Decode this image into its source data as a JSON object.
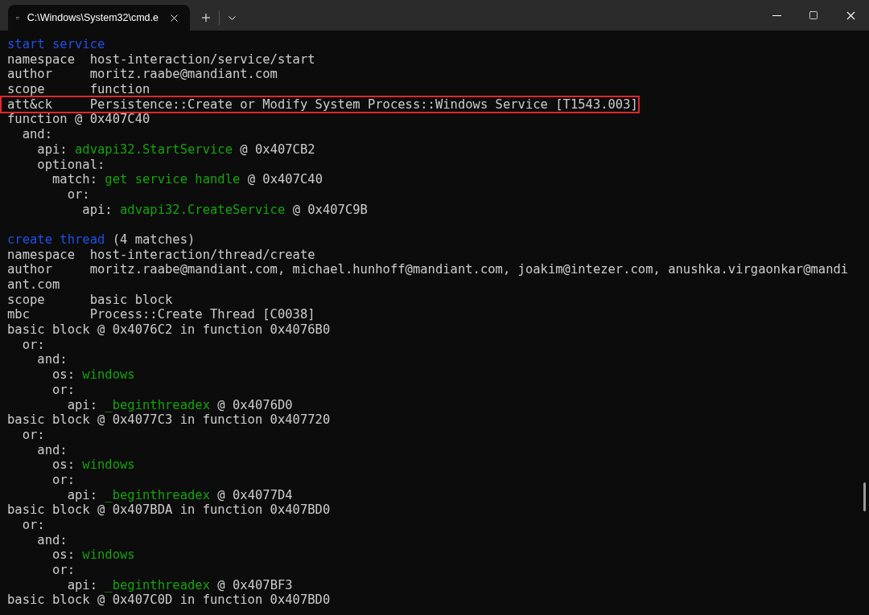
{
  "window": {
    "tab_title": "C:\\Windows\\System32\\cmd.e"
  },
  "lines": [
    {
      "segments": [
        {
          "text": "start service",
          "kind": "heading"
        }
      ]
    },
    {
      "segments": [
        {
          "text": "namespace  host-interaction/service/start",
          "kind": "plain"
        }
      ]
    },
    {
      "segments": [
        {
          "text": "author     moritz.raabe@mandiant.com",
          "kind": "plain"
        }
      ]
    },
    {
      "segments": [
        {
          "text": "scope      function",
          "kind": "plain"
        }
      ]
    },
    {
      "highlighted": true,
      "segments": [
        {
          "text": "att&ck     Persistence::Create or Modify System Process::Windows Service [T1543.003]",
          "kind": "plain"
        }
      ]
    },
    {
      "segments": [
        {
          "text": "function @ 0x407C40",
          "kind": "plain"
        }
      ]
    },
    {
      "segments": [
        {
          "text": "  and:",
          "kind": "plain"
        }
      ]
    },
    {
      "segments": [
        {
          "text": "    api: ",
          "kind": "plain"
        },
        {
          "text": "advapi32.StartService",
          "kind": "match"
        },
        {
          "text": " @ 0x407CB2",
          "kind": "plain"
        }
      ]
    },
    {
      "segments": [
        {
          "text": "    optional:",
          "kind": "plain"
        }
      ]
    },
    {
      "segments": [
        {
          "text": "      match: ",
          "kind": "plain"
        },
        {
          "text": "get service handle",
          "kind": "match"
        },
        {
          "text": " @ 0x407C40",
          "kind": "plain"
        }
      ]
    },
    {
      "segments": [
        {
          "text": "        or:",
          "kind": "plain"
        }
      ]
    },
    {
      "segments": [
        {
          "text": "          api: ",
          "kind": "plain"
        },
        {
          "text": "advapi32.CreateService",
          "kind": "match"
        },
        {
          "text": " @ 0x407C9B",
          "kind": "plain"
        }
      ]
    },
    {
      "gap_before": true,
      "segments": [
        {
          "text": "create thread",
          "kind": "heading"
        },
        {
          "text": " (4 matches)",
          "kind": "plain"
        }
      ]
    },
    {
      "segments": [
        {
          "text": "namespace  host-interaction/thread/create",
          "kind": "plain"
        }
      ]
    },
    {
      "segments": [
        {
          "text": "author     moritz.raabe@mandiant.com, michael.hunhoff@mandiant.com, joakim@intezer.com, anushka.virgaonkar@mandi",
          "kind": "plain"
        }
      ]
    },
    {
      "segments": [
        {
          "text": "ant.com",
          "kind": "plain"
        }
      ]
    },
    {
      "segments": [
        {
          "text": "scope      basic block",
          "kind": "plain"
        }
      ]
    },
    {
      "segments": [
        {
          "text": "mbc        Process::Create Thread [C0038]",
          "kind": "plain"
        }
      ]
    },
    {
      "segments": [
        {
          "text": "basic block @ 0x4076C2 in function 0x4076B0",
          "kind": "plain"
        }
      ]
    },
    {
      "segments": [
        {
          "text": "  or:",
          "kind": "plain"
        }
      ]
    },
    {
      "segments": [
        {
          "text": "    and:",
          "kind": "plain"
        }
      ]
    },
    {
      "segments": [
        {
          "text": "      os: ",
          "kind": "plain"
        },
        {
          "text": "windows",
          "kind": "match"
        }
      ]
    },
    {
      "segments": [
        {
          "text": "      or:",
          "kind": "plain"
        }
      ]
    },
    {
      "segments": [
        {
          "text": "        api: ",
          "kind": "plain"
        },
        {
          "text": "_beginthreadex",
          "kind": "match"
        },
        {
          "text": " @ 0x4076D0",
          "kind": "plain"
        }
      ]
    },
    {
      "segments": [
        {
          "text": "basic block @ 0x4077C3 in function 0x407720",
          "kind": "plain"
        }
      ]
    },
    {
      "segments": [
        {
          "text": "  or:",
          "kind": "plain"
        }
      ]
    },
    {
      "segments": [
        {
          "text": "    and:",
          "kind": "plain"
        }
      ]
    },
    {
      "segments": [
        {
          "text": "      os: ",
          "kind": "plain"
        },
        {
          "text": "windows",
          "kind": "match"
        }
      ]
    },
    {
      "segments": [
        {
          "text": "      or:",
          "kind": "plain"
        }
      ]
    },
    {
      "segments": [
        {
          "text": "        api: ",
          "kind": "plain"
        },
        {
          "text": "_beginthreadex",
          "kind": "match"
        },
        {
          "text": " @ 0x4077D4",
          "kind": "plain"
        }
      ]
    },
    {
      "segments": [
        {
          "text": "basic block @ 0x407BDA in function 0x407BD0",
          "kind": "plain"
        }
      ]
    },
    {
      "segments": [
        {
          "text": "  or:",
          "kind": "plain"
        }
      ]
    },
    {
      "segments": [
        {
          "text": "    and:",
          "kind": "plain"
        }
      ]
    },
    {
      "segments": [
        {
          "text": "      os: ",
          "kind": "plain"
        },
        {
          "text": "windows",
          "kind": "match"
        }
      ]
    },
    {
      "segments": [
        {
          "text": "      or:",
          "kind": "plain"
        }
      ]
    },
    {
      "segments": [
        {
          "text": "        api: ",
          "kind": "plain"
        },
        {
          "text": "_beginthreadex",
          "kind": "match"
        },
        {
          "text": " @ 0x407BF3",
          "kind": "plain"
        }
      ]
    },
    {
      "segments": [
        {
          "text": "basic block @ 0x407C0D in function 0x407BD0",
          "kind": "plain"
        }
      ]
    }
  ]
}
